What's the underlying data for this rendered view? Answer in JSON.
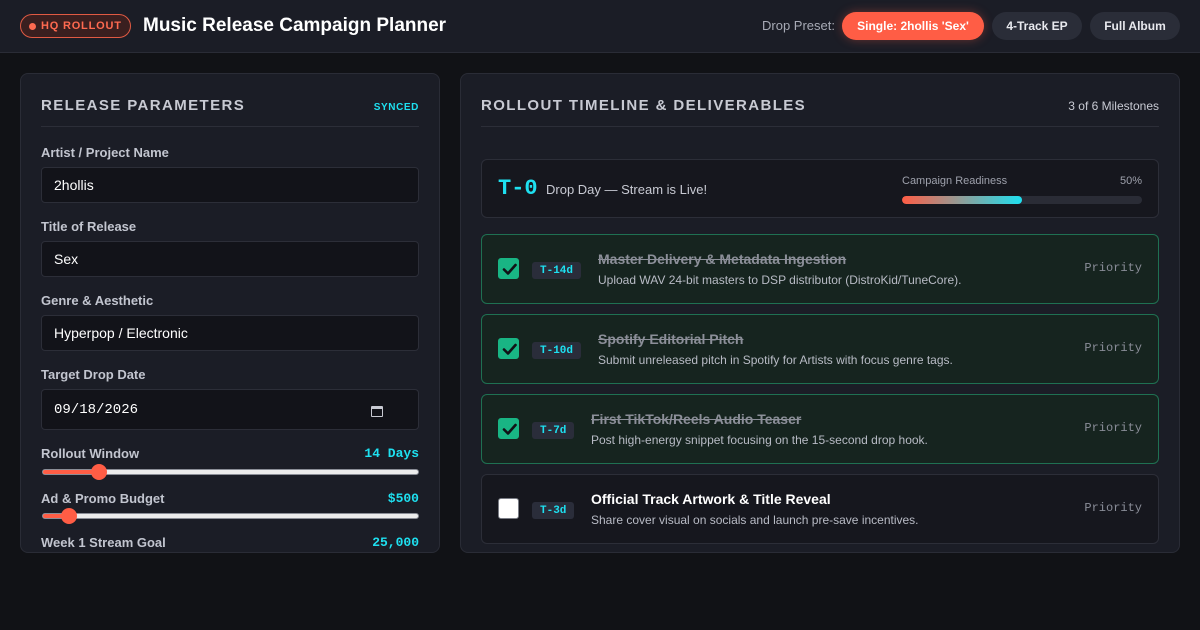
{
  "header": {
    "badge": "HQ ROLLOUT",
    "title": "Music Release Campaign Planner",
    "preset_label": "Drop Preset:",
    "presets": [
      "Single: 2hollis 'Sex'",
      "4-Track EP",
      "Full Album"
    ],
    "active_preset": "Single: 2hollis 'Sex'"
  },
  "params": {
    "title": "RELEASE PARAMETERS",
    "status": "SYNCED",
    "artist_label": "Artist / Project Name",
    "artist_value": "2hollis",
    "release_label": "Title of Release",
    "release_value": "Sex",
    "genre_label": "Genre & Aesthetic",
    "genre_value": "Hyperpop / Electronic",
    "date_label": "Target Drop Date",
    "date_value": "09/18/2026",
    "window_label": "Rollout Window",
    "window_value": "14 Days",
    "window_level": 0.15,
    "budget_label": "Ad & Promo Budget",
    "budget_value": "$500",
    "budget_level": 0.07,
    "goal_label": "Week 1 Stream Goal",
    "goal_value": "25,000"
  },
  "timeline": {
    "title": "ROLLOUT TIMELINE & DELIVERABLES",
    "count": "3 of 6 Milestones",
    "drop_code": "T-0",
    "drop_text": "Drop Day — Stream is Live!",
    "readiness_label": "Campaign Readiness",
    "readiness_text": "50%",
    "readiness": 0.5,
    "tasks": [
      {
        "tag": "T-14d",
        "title": "Master Delivery & Metadata Ingestion",
        "desc": "Upload WAV 24-bit masters to DSP distributor (DistroKid/TuneCore).",
        "priority": "Priority",
        "done": true
      },
      {
        "tag": "T-10d",
        "title": "Spotify Editorial Pitch",
        "desc": "Submit unreleased pitch in Spotify for Artists with focus genre tags.",
        "priority": "Priority",
        "done": true
      },
      {
        "tag": "T-7d",
        "title": "First TikTok/Reels Audio Teaser",
        "desc": "Post high-energy snippet focusing on the 15-second drop hook.",
        "priority": "Priority",
        "done": true
      },
      {
        "tag": "T-3d",
        "title": "Official Track Artwork & Title Reveal",
        "desc": "Share cover visual on socials and launch pre-save incentives.",
        "priority": "Priority",
        "done": false
      }
    ]
  },
  "colors": {
    "accent": "#ff5d45",
    "cyan": "#1ee0f0",
    "success": "#19b584"
  }
}
